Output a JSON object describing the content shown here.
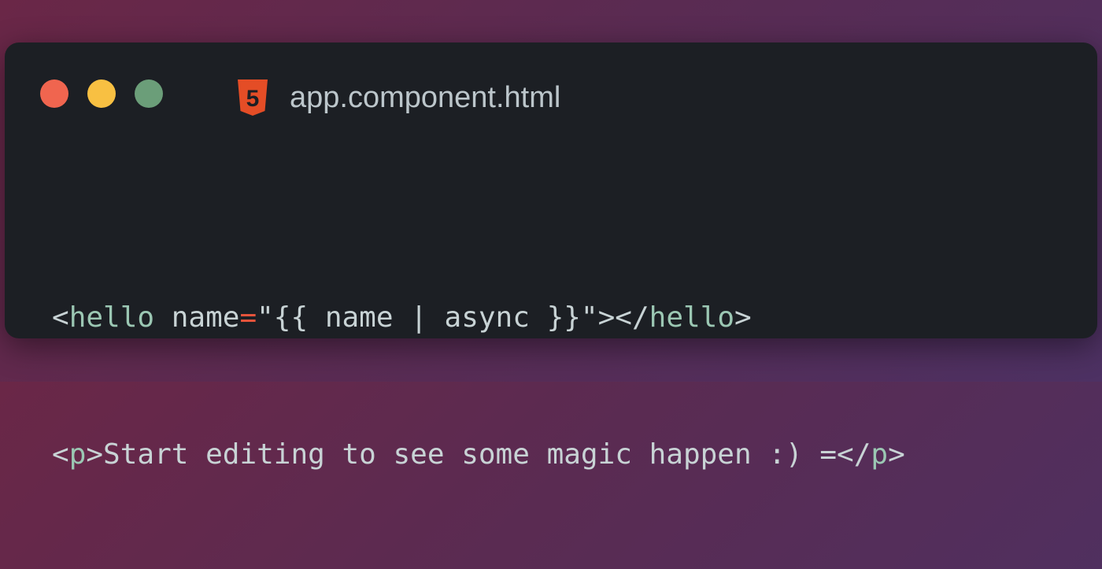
{
  "window": {
    "controls": {
      "close_color": "#f0654f",
      "minimize_color": "#f8c042",
      "zoom_color": "#6b9e79"
    },
    "file": {
      "icon": "html5-icon",
      "icon_label": "5",
      "icon_color": "#e44d26",
      "name": "app.component.html"
    }
  },
  "code": {
    "colors": {
      "tag": "#9bc7b3",
      "operator": "#e5533b",
      "text": "#c8d3d5"
    },
    "lines": [
      [
        {
          "text": "<",
          "type": "text"
        },
        {
          "text": "hello",
          "type": "tag"
        },
        {
          "text": " name",
          "type": "text"
        },
        {
          "text": "=",
          "type": "operator"
        },
        {
          "text": "\"{{ name | async }}\">",
          "type": "text"
        },
        {
          "text": "</",
          "type": "text"
        },
        {
          "text": "hello",
          "type": "tag"
        },
        {
          "text": ">",
          "type": "text"
        }
      ],
      [
        {
          "text": "<",
          "type": "text"
        },
        {
          "text": "p",
          "type": "tag"
        },
        {
          "text": ">Start editing to see some magic happen :) =",
          "type": "text"
        },
        {
          "text": "</",
          "type": "text"
        },
        {
          "text": "p",
          "type": "tag"
        },
        {
          "text": ">",
          "type": "text"
        }
      ]
    ]
  }
}
